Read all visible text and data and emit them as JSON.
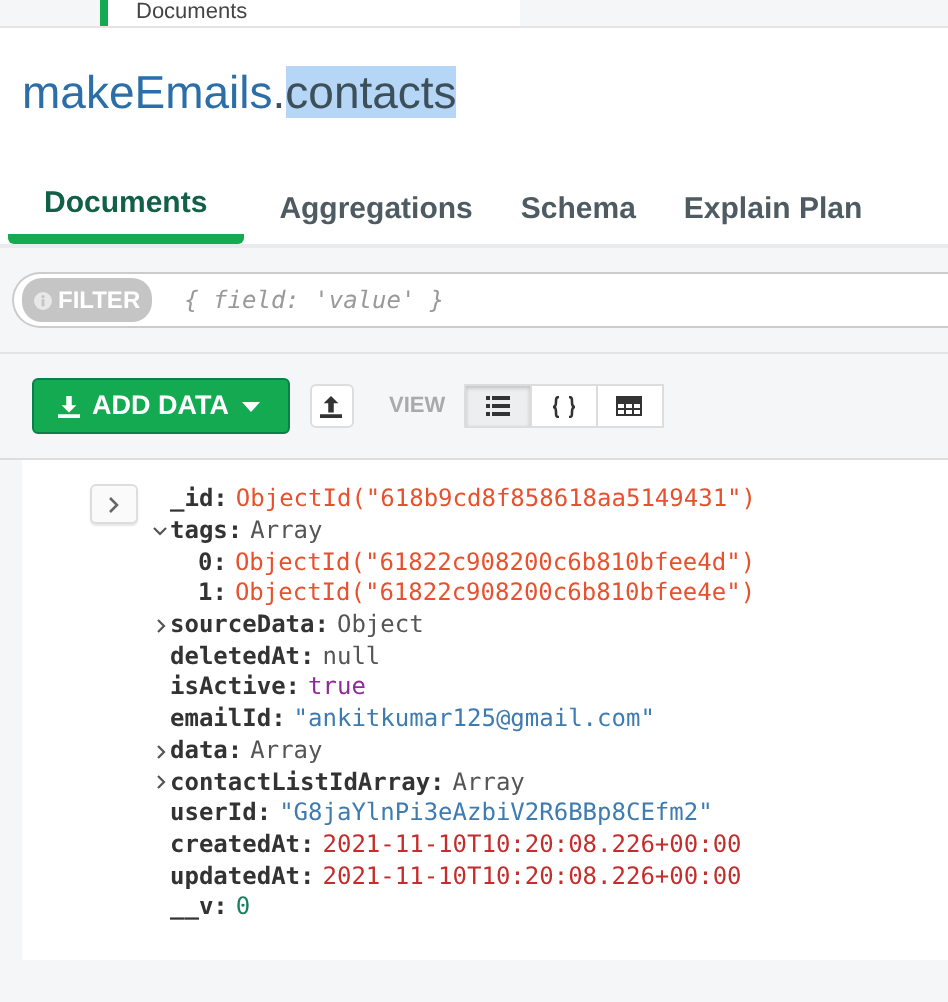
{
  "top_tab": {
    "label": "Documents"
  },
  "title": {
    "database": "makeEmails",
    "separator": ".",
    "collection": "contacts"
  },
  "tabs": [
    {
      "label": "Documents",
      "selected": true
    },
    {
      "label": "Aggregations",
      "selected": false
    },
    {
      "label": "Schema",
      "selected": false
    },
    {
      "label": "Explain Plan",
      "selected": false
    }
  ],
  "filter": {
    "label": "FILTER",
    "placeholder": "{ field: 'value' }"
  },
  "toolbar": {
    "add_data": "ADD DATA",
    "view_label": "VIEW",
    "views": [
      {
        "kind": "list",
        "selected": true
      },
      {
        "kind": "json",
        "selected": false
      },
      {
        "kind": "table",
        "selected": false
      }
    ]
  },
  "document": {
    "fields": [
      {
        "key": "_id:",
        "value": "ObjectId(\"618b9cd8f858618aa5149431\")",
        "kind": "objectid"
      },
      {
        "key": "tags:",
        "value": "Array",
        "kind": "type",
        "expanded": true,
        "children": [
          {
            "key": "0:",
            "value": "ObjectId(\"61822c908200c6b810bfee4d\")",
            "kind": "objectid"
          },
          {
            "key": "1:",
            "value": "ObjectId(\"61822c908200c6b810bfee4e\")",
            "kind": "objectid"
          }
        ]
      },
      {
        "key": "sourceData:",
        "value": "Object",
        "kind": "type",
        "expanded": false
      },
      {
        "key": "deletedAt:",
        "value": "null",
        "kind": "null"
      },
      {
        "key": "isActive:",
        "value": "true",
        "kind": "bool"
      },
      {
        "key": "emailId:",
        "value": "\"ankitkumar125@gmail.com\"",
        "kind": "string"
      },
      {
        "key": "data:",
        "value": "Array",
        "kind": "type",
        "expanded": false
      },
      {
        "key": "contactListIdArray:",
        "value": "Array",
        "kind": "type",
        "expanded": false
      },
      {
        "key": "userId:",
        "value": "\"G8jaYlnPi3eAzbiV2R6BBp8CEfm2\"",
        "kind": "string"
      },
      {
        "key": "createdAt:",
        "value": "2021-11-10T10:20:08.226+00:00",
        "kind": "date"
      },
      {
        "key": "updatedAt:",
        "value": "2021-11-10T10:20:08.226+00:00",
        "kind": "date"
      },
      {
        "key": "__v:",
        "value": "0",
        "kind": "number"
      }
    ]
  }
}
